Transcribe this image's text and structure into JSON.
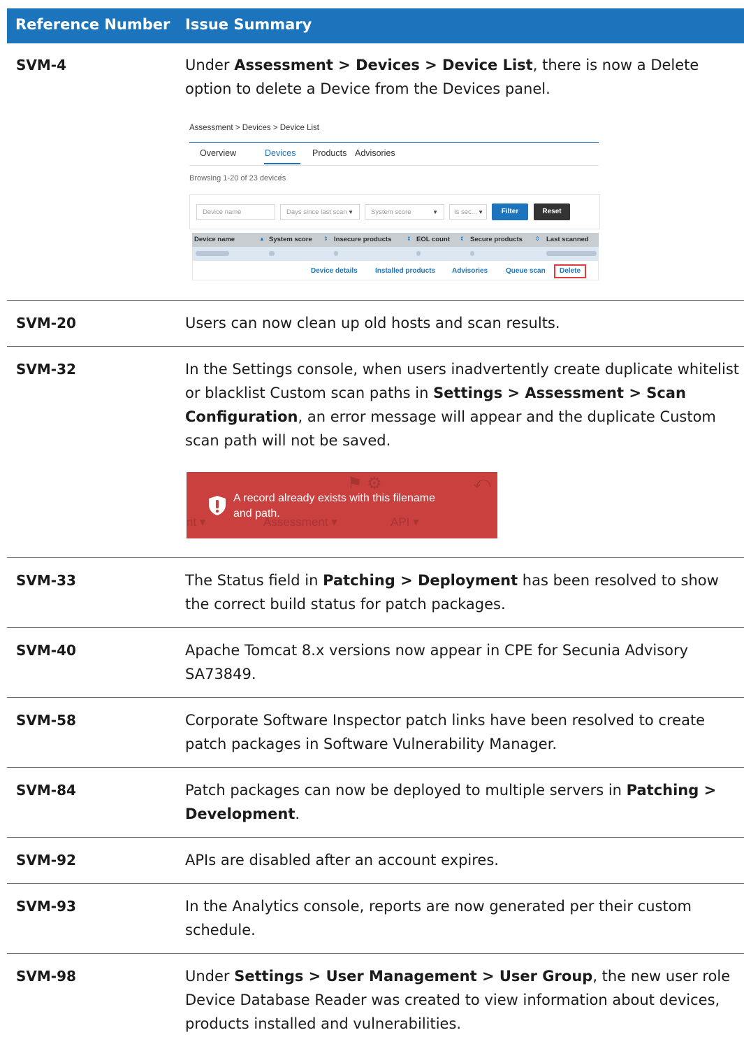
{
  "header": {
    "col1": "Reference Number",
    "col2": "Issue Summary"
  },
  "rows": [
    {
      "ref": "SVM-4",
      "parts": [
        {
          "t": "Under "
        },
        {
          "t": "Assessment > Devices > Device List",
          "b": true
        },
        {
          "t": ", there is now a Delete option to delete a Device from the Devices panel."
        }
      ]
    },
    {
      "ref": "SVM-20",
      "parts": [
        {
          "t": "Users can now clean up old hosts and scan results."
        }
      ]
    },
    {
      "ref": "SVM-32",
      "parts": [
        {
          "t": "In the Settings console, when users inadvertently create duplicate whitelist or blacklist Custom scan paths in "
        },
        {
          "t": "Settings > Assessment > Scan Configuration",
          "b": true
        },
        {
          "t": ", an error message will appear and the duplicate Custom scan path will not be saved."
        }
      ]
    },
    {
      "ref": "SVM-33",
      "parts": [
        {
          "t": "The Status field in "
        },
        {
          "t": "Patching > Deployment",
          "b": true
        },
        {
          "t": " has been resolved to show the correct build status for patch packages."
        }
      ]
    },
    {
      "ref": "SVM-40",
      "parts": [
        {
          "t": "Apache Tomcat 8.x versions now appear in CPE for Secunia Advisory SA73849."
        }
      ]
    },
    {
      "ref": "SVM-58",
      "parts": [
        {
          "t": "Corporate Software Inspector patch links have been resolved to create patch packages in Software Vulnerability Manager."
        }
      ]
    },
    {
      "ref": "SVM-84",
      "parts": [
        {
          "t": "Patch packages can now be deployed to multiple servers in "
        },
        {
          "t": "Patching > Development",
          "b": true
        },
        {
          "t": "."
        }
      ]
    },
    {
      "ref": "SVM-92",
      "parts": [
        {
          "t": "APIs are disabled after an account expires."
        }
      ]
    },
    {
      "ref": "SVM-93",
      "parts": [
        {
          "t": "In the Analytics console, reports are now generated per their custom schedule."
        }
      ]
    },
    {
      "ref": "SVM-98",
      "parts": [
        {
          "t": "Under "
        },
        {
          "t": "Settings > User Management > User Group",
          "b": true
        },
        {
          "t": ", the new user role Device Database Reader was created to view information about devices, products installed and vulnerabilities."
        }
      ]
    }
  ],
  "device_shot": {
    "breadcrumb": "Assessment > Devices > Device List",
    "tabs": [
      "Overview",
      "Devices",
      "Products",
      "Advisories"
    ],
    "active_tab": "Devices",
    "browsing": "Browsing 1-20 of 23 devices",
    "filters": {
      "device_name_placeholder": "Device name",
      "days_since_last_scan": "Days since last scan",
      "system_score": "System score",
      "is_secure": "Is sec..."
    },
    "filter_label": "Filter",
    "reset_label": "Reset",
    "columns": [
      "Device name",
      "System score",
      "Insecure products",
      "EOL count",
      "Secure products",
      "Last scanned"
    ],
    "actions": [
      "Device details",
      "Installed products",
      "Advisories",
      "Queue scan",
      "Delete"
    ],
    "colors": {
      "accent": "#1c75bc",
      "highlight_border": "#e03c3c",
      "reset_button": "#333333"
    }
  },
  "error_shot": {
    "message": "A record already exists with this filename and path.",
    "icon": "shield-alert-icon",
    "background": "#c9403f"
  }
}
